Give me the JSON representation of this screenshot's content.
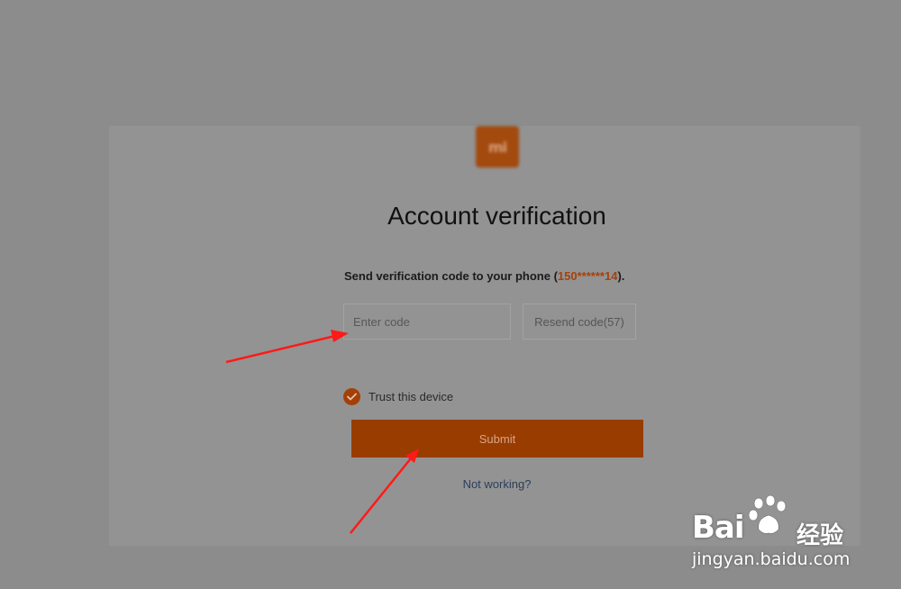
{
  "brand": {
    "logo_text": "mi",
    "accent_color": "#a34006"
  },
  "page": {
    "title": "Account verification",
    "description_prefix": "Send verification code to your phone (",
    "phone_masked": "150******14",
    "description_suffix": ")."
  },
  "code_input": {
    "placeholder": "Enter code",
    "value": ""
  },
  "resend_button": {
    "label": "Resend code(57)"
  },
  "trust_device": {
    "label": "Trust this device",
    "checked": true
  },
  "submit_button": {
    "label": "Submit"
  },
  "help_link": {
    "label": "Not working?"
  },
  "watermark": {
    "brand": "Bai",
    "brand_cn": "经验",
    "url": "jingyan.baidu.com"
  },
  "annotation_color": "#ff1a1a"
}
